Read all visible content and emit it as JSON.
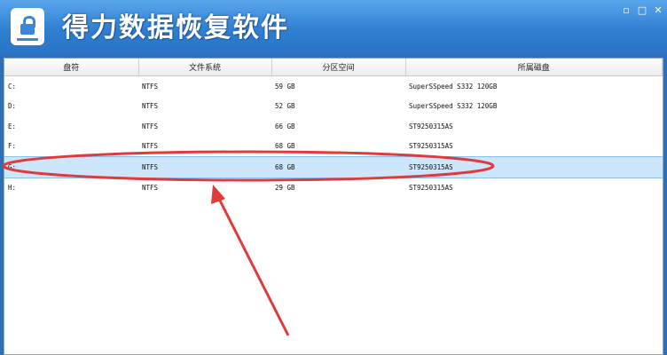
{
  "window": {
    "title": "得力数据恢复软件",
    "controls": [
      "▫",
      "□",
      "✕"
    ]
  },
  "table": {
    "columns": [
      "盘符",
      "文件系统",
      "分区空间",
      "所属磁盘"
    ],
    "rows": [
      {
        "drive": "C:",
        "fs": "NTFS",
        "size": "59 GB",
        "disk": "SuperSSpeed S332 120GB"
      },
      {
        "drive": "D:",
        "fs": "NTFS",
        "size": "52 GB",
        "disk": "SuperSSpeed S332 120GB"
      },
      {
        "drive": "E:",
        "fs": "NTFS",
        "size": "66 GB",
        "disk": "ST9250315AS"
      },
      {
        "drive": "F:",
        "fs": "NTFS",
        "size": "68 GB",
        "disk": "ST9250315AS"
      },
      {
        "drive": "G:",
        "fs": "NTFS",
        "size": "68 GB",
        "disk": "ST9250315AS"
      },
      {
        "drive": "H:",
        "fs": "NTFS",
        "size": "29 GB",
        "disk": "ST9250315AS"
      }
    ],
    "selected_index": 4
  },
  "colors": {
    "titlebar": "#2f7fd2",
    "selection": "#cde6fb",
    "annotation": "#e03a3a"
  }
}
